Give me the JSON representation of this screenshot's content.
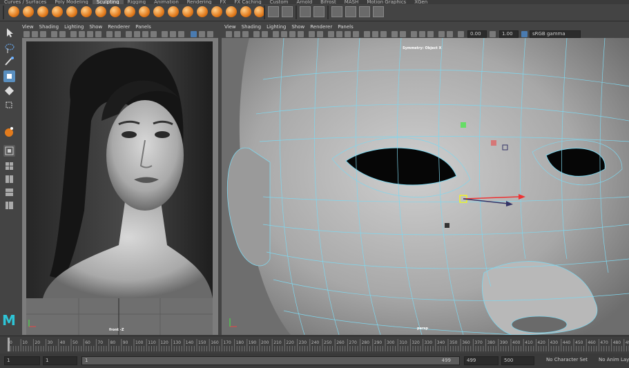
{
  "shelf_tabs": [
    "Curves / Surfaces",
    "Poly Modeling",
    "Sculpting",
    "Rigging",
    "Animation",
    "Rendering",
    "FX",
    "FX Caching",
    "Custom",
    "Arnold",
    "Bifrost",
    "MASH",
    "Motion Graphics",
    "XGen"
  ],
  "active_shelf_tab": "Sculpting",
  "left_panel": {
    "menu": [
      "View",
      "Shading",
      "Lighting",
      "Show",
      "Renderer",
      "Panels"
    ],
    "camera_label": "front -Z"
  },
  "right_panel": {
    "menu": [
      "View",
      "Shading",
      "Lighting",
      "Show",
      "Renderer",
      "Panels"
    ],
    "camera_label": "persp",
    "symmetry_label": "Symmetry: Object X",
    "exposure": "0.00",
    "gamma": "1.00",
    "color_space": "sRGB gamma"
  },
  "timeline": {
    "ticks": [
      "0",
      "10",
      "20",
      "30",
      "40",
      "50",
      "60",
      "70",
      "80",
      "90",
      "100",
      "110",
      "120",
      "130",
      "140",
      "150",
      "160",
      "170",
      "180",
      "190",
      "200",
      "210",
      "220",
      "230",
      "240",
      "250",
      "260",
      "270",
      "280",
      "290",
      "300",
      "310",
      "320",
      "330",
      "340",
      "350",
      "360",
      "370",
      "380",
      "390",
      "400",
      "410",
      "420",
      "430",
      "440",
      "450",
      "460",
      "470",
      "480",
      "490"
    ]
  },
  "range": {
    "start_field": "1",
    "start_inner": "1",
    "slider_start": "1",
    "slider_end": "499",
    "end_inner": "499",
    "end_field": "500",
    "character_set": "No Character Set",
    "anim_layer": "No Anim Layer"
  },
  "logo": "M",
  "accent": "#e27b1d"
}
